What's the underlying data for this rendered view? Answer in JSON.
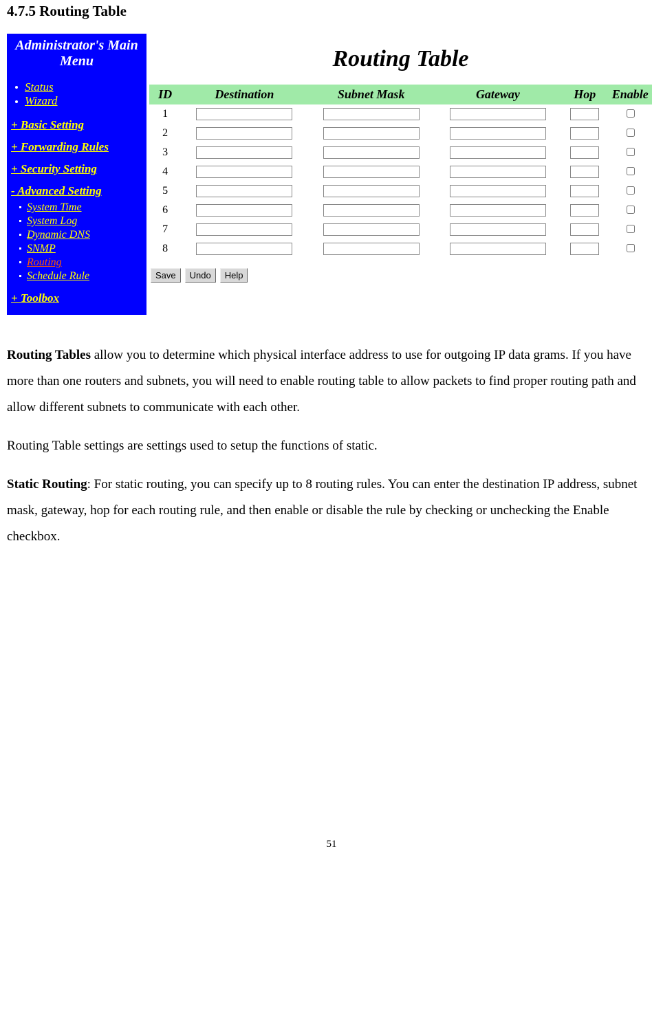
{
  "section_heading": "4.7.5 Routing Table",
  "sidebar": {
    "title_line1": "Administrator's Main",
    "title_line2": "Menu",
    "top_items": [
      "Status",
      "Wizard"
    ],
    "sections": [
      {
        "label": "+ Basic Setting",
        "subs": []
      },
      {
        "label": "+ Forwarding Rules",
        "subs": []
      },
      {
        "label": "+ Security Setting",
        "subs": []
      },
      {
        "label": "- Advanced Setting",
        "subs": [
          {
            "label": "System Time",
            "active": false
          },
          {
            "label": "System Log",
            "active": false
          },
          {
            "label": "Dynamic DNS",
            "active": false
          },
          {
            "label": "SNMP",
            "active": false
          },
          {
            "label": "Routing",
            "active": true
          },
          {
            "label": "Schedule Rule",
            "active": false
          }
        ]
      },
      {
        "label": "+ Toolbox",
        "subs": []
      }
    ]
  },
  "content": {
    "title": "Routing Table",
    "columns": {
      "id": "ID",
      "destination": "Destination",
      "subnet_mask": "Subnet Mask",
      "gateway": "Gateway",
      "hop": "Hop",
      "enable": "Enable"
    },
    "rows": [
      {
        "id": "1",
        "destination": "",
        "subnet_mask": "",
        "gateway": "",
        "hop": "",
        "enable": false
      },
      {
        "id": "2",
        "destination": "",
        "subnet_mask": "",
        "gateway": "",
        "hop": "",
        "enable": false
      },
      {
        "id": "3",
        "destination": "",
        "subnet_mask": "",
        "gateway": "",
        "hop": "",
        "enable": false
      },
      {
        "id": "4",
        "destination": "",
        "subnet_mask": "",
        "gateway": "",
        "hop": "",
        "enable": false
      },
      {
        "id": "5",
        "destination": "",
        "subnet_mask": "",
        "gateway": "",
        "hop": "",
        "enable": false
      },
      {
        "id": "6",
        "destination": "",
        "subnet_mask": "",
        "gateway": "",
        "hop": "",
        "enable": false
      },
      {
        "id": "7",
        "destination": "",
        "subnet_mask": "",
        "gateway": "",
        "hop": "",
        "enable": false
      },
      {
        "id": "8",
        "destination": "",
        "subnet_mask": "",
        "gateway": "",
        "hop": "",
        "enable": false
      }
    ],
    "buttons": {
      "save": "Save",
      "undo": "Undo",
      "help": "Help"
    }
  },
  "paragraphs": {
    "p1_bold": "Routing Tables",
    "p1_rest": " allow you to determine which physical interface address to use for outgoing IP data grams. If you have more than one routers and subnets, you will need to enable routing table to allow packets to find proper routing path and allow different subnets to communicate with each other.",
    "p2": "Routing Table settings are settings used to setup the functions of static.",
    "p3_bold": "Static Routing",
    "p3_rest": ": For static routing, you can specify up to 8 routing rules. You can enter the destination IP address, subnet mask, gateway, hop for each routing rule, and then enable or disable the rule by checking or unchecking the Enable checkbox."
  },
  "page_number": "51"
}
